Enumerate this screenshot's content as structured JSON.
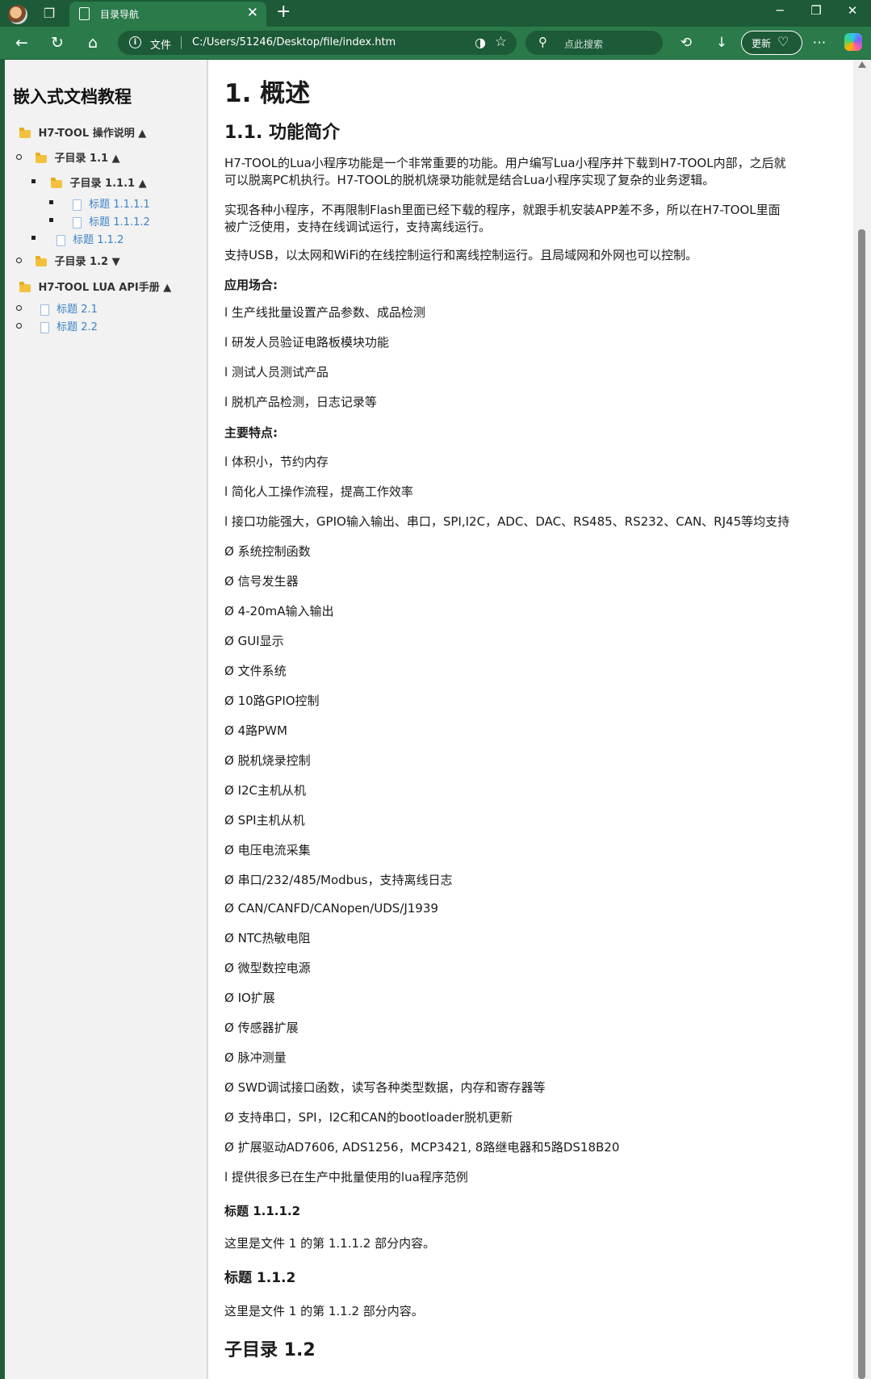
{
  "browser": {
    "tab_title": "目录导航",
    "address_scheme": "文件",
    "address_url": "C:/Users/51246/Desktop/file/index.htm",
    "search_placeholder": "点此搜索",
    "update_label": "更新"
  },
  "sidebar": {
    "title": "嵌入式文档教程",
    "items": [
      {
        "label": "H7-TOOL 操作说明 ▲"
      },
      {
        "label": "子目录 1.1 ▲"
      },
      {
        "label": "子目录 1.1.1 ▲"
      },
      {
        "label": "标题 1.1.1.1"
      },
      {
        "label": "标题 1.1.1.2"
      },
      {
        "label": "标题 1.1.2"
      },
      {
        "label": "子目录 1.2 ▼"
      },
      {
        "label": "H7-TOOL LUA API手册 ▲"
      },
      {
        "label": "标题 2.1"
      },
      {
        "label": "标题 2.2"
      }
    ]
  },
  "content": {
    "h1": "1. 概述",
    "h2": "1.1. 功能简介",
    "p1_line1": "H7-TOOL的Lua小程序功能是一个非常重要的功能。用户编写Lua小程序并下载到H7-TOOL内部，之后就",
    "p1_line2": "可以脱离PC机执行。H7-TOOL的脱机烧录功能就是结合Lua小程序实现了复杂的业务逻辑。",
    "p2_line1": "实现各种小程序，不再限制Flash里面已经下载的程序，就跟手机安装APP差不多，所以在H7-TOOL里面",
    "p2_line2": "被广泛使用，支持在线调试运行，支持离线运行。",
    "p3": "支持USB，以太网和WiFi的在线控制运行和离线控制运行。且局域网和外网也可以控制。",
    "apps_title": "应用场合:",
    "apps": [
      "l 生产线批量设置产品参数、成品检测",
      "l 研发人员验证电路板模块功能",
      "l 测试人员测试产品",
      "l 脱机产品检测，日志记录等"
    ],
    "features_title": "主要特点:",
    "features": [
      "l 体积小，节约内存",
      "l 简化人工操作流程，提高工作效率",
      "l 接口功能强大，GPIO输入输出、串口，SPI,I2C，ADC、DAC、RS485、RS232、CAN、RJ45等均支持",
      "Ø 系统控制函数",
      "Ø 信号发生器",
      "Ø 4-20mA输入输出",
      "Ø GUI显示",
      "Ø 文件系统",
      "Ø 10路GPIO控制",
      "Ø 4路PWM",
      "Ø 脱机烧录控制",
      "Ø I2C主机从机",
      "Ø SPI主机从机",
      "Ø 电压电流采集",
      "Ø 串口/232/485/Modbus，支持离线日志",
      "Ø CAN/CANFD/CANopen/UDS/J1939",
      "Ø NTC热敏电阻",
      "Ø 微型数控电源",
      "Ø IO扩展",
      "Ø 传感器扩展",
      "Ø 脉冲测量",
      "Ø SWD调试接口函数，读写各种类型数据，内存和寄存器等",
      "Ø 支持串口，SPI，I2C和CAN的bootloader脱机更新",
      "Ø 扩展驱动AD7606, ADS1256，MCP3421, 8路继电器和5路DS18B20",
      "l 提供很多已在生产中批量使用的lua程序范例"
    ],
    "h4_1": "标题 1.1.1.2",
    "p4": "这里是文件 1 的第 1.1.1.2 部分内容。",
    "h3_1": "标题 1.1.2",
    "p5": "这里是文件 1 的第 1.1.2 部分内容。",
    "h2_2": "子目录 1.2"
  }
}
